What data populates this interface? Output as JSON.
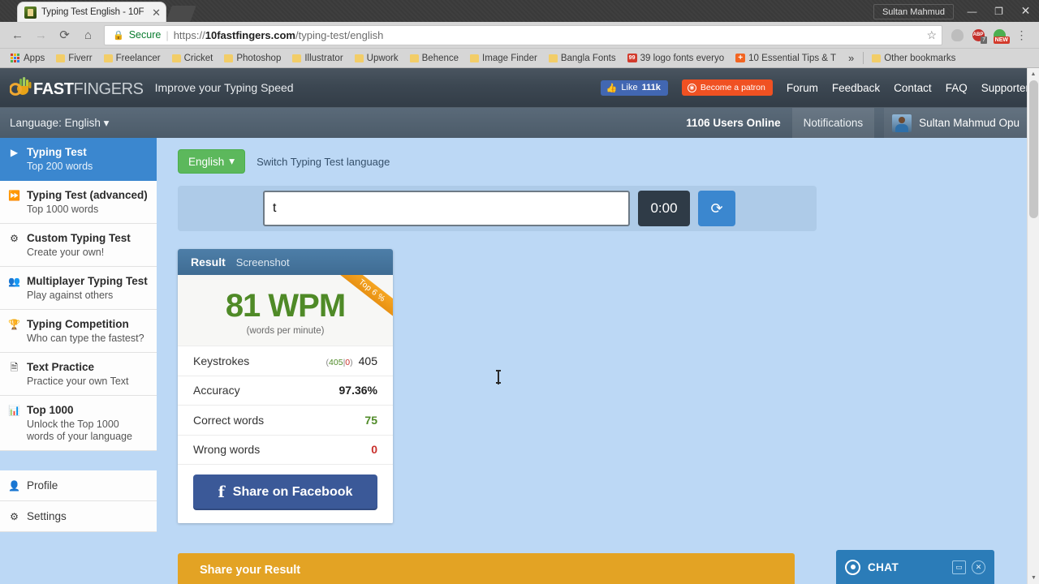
{
  "window": {
    "user_label": "Sultan Mahmud",
    "minimize": "—",
    "restore": "❐",
    "close": "✕"
  },
  "tab": {
    "title": "Typing Test English - 10F",
    "close": "✕",
    "favicon": "10fastfingers-favicon"
  },
  "nav": {
    "back": "←",
    "forward": "→",
    "reload": "⟳",
    "home": "⌂",
    "secure_label": "Secure",
    "url_scheme": "https://",
    "url_domain": "10fastfingers.com",
    "url_path": "/typing-test/english",
    "star": "☆",
    "menu": "⋮",
    "extensions": [
      {
        "name": "microphone-extension",
        "color": "#b8b8b8",
        "badge": ""
      },
      {
        "name": "adblock-plus-extension",
        "color": "#c4302b",
        "badge": "7",
        "glyph": "ABP"
      },
      {
        "name": "new-extension",
        "color": "#4caf50",
        "badge": "NEW"
      }
    ]
  },
  "bookmarks": {
    "apps_label": "Apps",
    "overflow": "»",
    "items": [
      {
        "label": "Fiverr",
        "icon": "folder"
      },
      {
        "label": "Freelancer",
        "icon": "folder"
      },
      {
        "label": "Cricket",
        "icon": "folder"
      },
      {
        "label": "Photoshop",
        "icon": "folder"
      },
      {
        "label": "Illustrator",
        "icon": "folder"
      },
      {
        "label": "Upwork",
        "icon": "folder"
      },
      {
        "label": "Behence",
        "icon": "folder"
      },
      {
        "label": "Image Finder",
        "icon": "folder"
      },
      {
        "label": "Bangla Fonts",
        "icon": "folder"
      },
      {
        "label": "39 logo fonts everyo",
        "icon": "red-favicon"
      },
      {
        "label": "10 Essential Tips & T",
        "icon": "orange-favicon"
      }
    ],
    "other_label": "Other bookmarks"
  },
  "site_header": {
    "logo_number": "10",
    "logo_bold": "FAST",
    "logo_light": "FINGERS",
    "tagline": "Improve your Typing Speed",
    "fb_like": "Like",
    "fb_count": "111k",
    "patron": "Become a patron",
    "links": [
      "Forum",
      "Feedback",
      "Contact",
      "FAQ",
      "Supporter"
    ]
  },
  "sub_header": {
    "language_label": "Language: English",
    "chevron": "▾",
    "users_online": "1106 Users Online",
    "notifications": "Notifications",
    "username": "Sultan Mahmud Opu"
  },
  "sidebar": {
    "items": [
      {
        "title": "Typing Test",
        "sub": "Top 200 words",
        "icon": "play-icon",
        "icon_glyph": "▶",
        "active": true
      },
      {
        "title": "Typing Test (advanced)",
        "sub": "Top 1000 words",
        "icon": "fast-forward-icon",
        "icon_glyph": "▶▶",
        "active": false
      },
      {
        "title": "Custom Typing Test",
        "sub": "Create your own!",
        "icon": "gears-icon",
        "icon_glyph": "✾",
        "active": false
      },
      {
        "title": "Multiplayer Typing Test",
        "sub": "Play against others",
        "icon": "users-icon",
        "icon_glyph": "👥",
        "active": false
      },
      {
        "title": "Typing Competition",
        "sub": "Who can type the fastest?",
        "icon": "trophy-icon",
        "icon_glyph": "🏆",
        "active": false
      },
      {
        "title": "Text Practice",
        "sub": "Practice your own Text",
        "icon": "document-icon",
        "icon_glyph": "📄",
        "active": false
      },
      {
        "title": "Top 1000",
        "sub": "Unlock the Top 1000 words of your language",
        "icon": "bar-chart-icon",
        "icon_glyph": "▁▃▅",
        "active": false
      }
    ],
    "footer_items": [
      {
        "title": "Profile",
        "icon": "user-icon",
        "icon_glyph": "👤"
      },
      {
        "title": "Settings",
        "icon": "gear-icon",
        "icon_glyph": "⚙"
      }
    ]
  },
  "main": {
    "language_button": "English",
    "language_chevron": "▾",
    "switch_note": "Switch Typing Test language",
    "typing_input_value": "t",
    "typing_input_placeholder": "",
    "timer": "0:00",
    "reload_glyph": "⟳"
  },
  "result_card": {
    "tab_result": "Result",
    "tab_screenshot": "Screenshot",
    "ribbon": "Top 6 %",
    "wpm": "81 WPM",
    "wpm_sub": "(words per minute)",
    "stats": [
      {
        "label": "Keystrokes",
        "paren_correct": "405",
        "paren_sep": "|",
        "paren_wrong": "0",
        "value": "405",
        "style": "plain"
      },
      {
        "label": "Accuracy",
        "value": "97.36%",
        "style": "bold"
      },
      {
        "label": "Correct words",
        "value": "75",
        "style": "green"
      },
      {
        "label": "Wrong words",
        "value": "0",
        "style": "red"
      }
    ],
    "share_facebook": "Share on Facebook",
    "fb_glyph": "f"
  },
  "share_banner": {
    "title": "Share your Result"
  },
  "chat": {
    "label": "CHAT",
    "minimize": "▭",
    "close": "✕",
    "icon": "chat-target-icon"
  },
  "scrollbar": {
    "up": "▲",
    "down": "▼"
  },
  "colors": {
    "page_bg": "#bcd8f5",
    "accent_blue": "#3b87cf",
    "green": "#4f8a27",
    "red": "#c9302c",
    "orange": "#e3a324",
    "facebook": "#3b5998"
  }
}
